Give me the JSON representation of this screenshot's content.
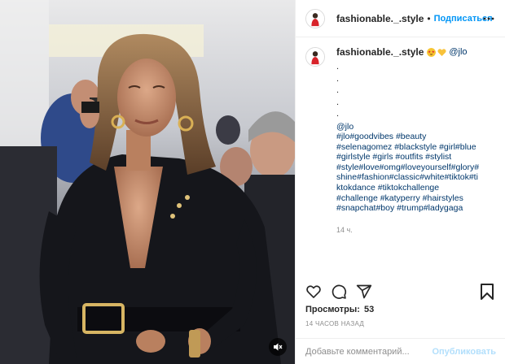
{
  "post": {
    "username": "fashionable._.style",
    "follow_label": "Подписаться",
    "caption": {
      "username": "fashionable._.style",
      "emoji_icons": [
        "star-struck-emoji",
        "yellow-heart-emoji"
      ],
      "mention": "@jlo",
      "dot_lines": [
        ".",
        ".",
        ".",
        ".",
        "."
      ],
      "hashtag_lines": [
        "@jlo",
        "#jlo#goodvibes #beauty",
        "#selenagomez #blackstyle #girl#blue",
        "#girlstyle #girls #outfits #stylist",
        "#style#love#omg#loveyourself#glory#",
        "shine#fashion#classic#white#tiktok#ti",
        "ktokdance #tiktokchallenge",
        "#challenge #katyperry #hairstyles",
        "#snapchat#boy #trump#ladygaga"
      ],
      "time_ago": "14 ч."
    },
    "views_label": "Просмотры:",
    "views_count": "53",
    "date": "14 ЧАСОВ НАЗАД",
    "comment_placeholder": "Добавьте комментарий...",
    "post_label": "Опубликовать",
    "icons": {
      "more": "more-options-icon",
      "like": "heart-icon",
      "comment": "comment-icon",
      "share": "share-icon",
      "save": "bookmark-icon",
      "mute": "speaker-muted-icon"
    },
    "colors": {
      "link": "#00376b",
      "follow": "#0095f6",
      "post_disabled": "#b2dffc",
      "muted_text": "#8e8e8e"
    }
  }
}
